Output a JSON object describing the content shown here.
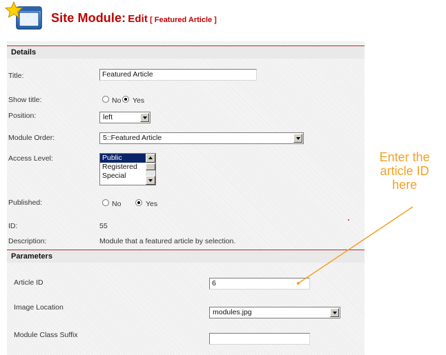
{
  "header": {
    "title": "Site Module:",
    "subtitle": "Edit",
    "bracket": "[ Featured Article ]",
    "icon": "module-edit-icon"
  },
  "details": {
    "section_title": "Details",
    "title_label": "Title:",
    "title_value": "Featured Article",
    "show_title_label": "Show title:",
    "show_title_no": "No",
    "show_title_yes": "Yes",
    "show_title_selected": "Yes",
    "position_label": "Position:",
    "position_value": "left",
    "order_label": "Module Order:",
    "order_value": "5::Featured Article",
    "access_label": "Access Level:",
    "access_options": [
      "Public",
      "Registered",
      "Special"
    ],
    "access_selected": "Public",
    "published_label": "Published:",
    "published_no": "No",
    "published_yes": "Yes",
    "published_selected": "Yes",
    "id_label": "ID:",
    "id_value": "55",
    "desc_label": "Description:",
    "desc_value": "Module that a featured article by selection."
  },
  "parameters": {
    "section_title": "Parameters",
    "article_id_label": "Article ID",
    "article_id_value": "6",
    "image_loc_label": "Image Location",
    "image_loc_value": "modules.jpg",
    "suffix_label": "Module Class Suffix",
    "suffix_value": ""
  },
  "callout": {
    "line1": "Enter the",
    "line2": "article ID",
    "line3": "here",
    "color": "#f5a020"
  },
  "colors": {
    "accent_red": "#c00000",
    "section_rule": "#c1272d",
    "listbox_selected": "#0a246a"
  }
}
